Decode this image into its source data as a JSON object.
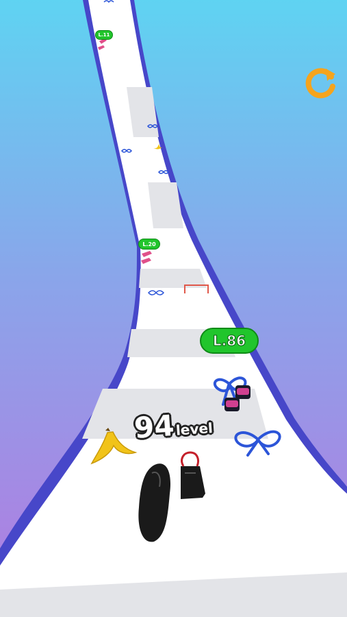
{
  "hud": {
    "restart_icon": "restart-arrow-icon",
    "accent": "#f5a41d"
  },
  "gates": {
    "l11": "L.11",
    "l20": "L.20",
    "l86": "L.86"
  },
  "player": {
    "level_number": "94",
    "level_word": "level"
  },
  "colors": {
    "sky_top": "#5fd3f2",
    "sky_bottom": "#b37ae0",
    "track": "#ffffff",
    "track_edge": "#4747c9",
    "badge_green": "#21c52c",
    "bow_blue": "#2c55d8",
    "banana": "#f1c319",
    "boot": "#1a1a1a"
  }
}
